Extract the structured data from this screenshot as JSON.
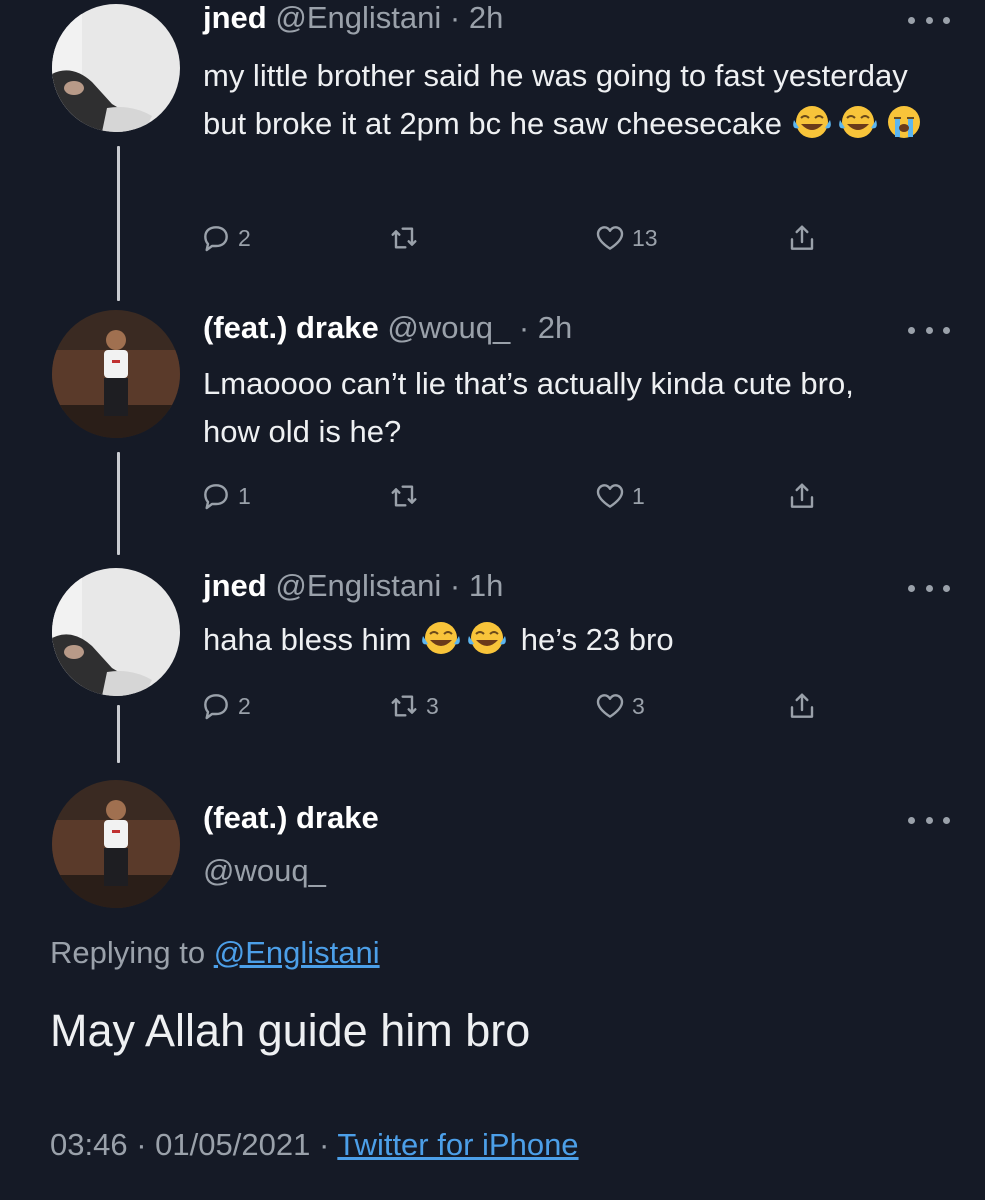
{
  "tweets": [
    {
      "name": "jned",
      "handle": "@Englistani",
      "time": "2h",
      "text": "my little brother said he was going to fast yesterday but broke it at 2pm bc he saw cheesecake",
      "emojis": [
        "tears-of-joy-emoji",
        "tears-of-joy-emoji",
        "loudly-crying-emoji"
      ],
      "replies": "2",
      "retweets": "",
      "likes": "13"
    },
    {
      "name": "(feat.) drake",
      "handle": "@wouq_",
      "time": "2h",
      "text": "Lmaoooo can’t lie that’s actually kinda cute bro, how old is he?",
      "replies": "1",
      "retweets": "",
      "likes": "1"
    },
    {
      "name": "jned",
      "handle": "@Englistani",
      "time": "1h",
      "text_before": "haha bless him",
      "text_after": "he’s 23 bro",
      "emojis": [
        "tears-of-joy-emoji",
        "tears-of-joy-emoji"
      ],
      "replies": "2",
      "retweets": "3",
      "likes": "3"
    }
  ],
  "separator": "·",
  "main": {
    "name": "(feat.) drake",
    "handle": "@wouq_",
    "replying_prefix": "Replying to",
    "replying_handle": "@Englistani",
    "text": "May Allah guide him bro",
    "time": "03:46",
    "date": "01/05/2021",
    "client": "Twitter for iPhone"
  },
  "icons": [
    "more-icon",
    "reply-icon",
    "retweet-icon",
    "like-icon",
    "share-icon"
  ],
  "colors": {
    "background": "#151a26",
    "text": "#e7e9ea",
    "muted": "#9aa1aa",
    "link": "#4c9fe8"
  }
}
